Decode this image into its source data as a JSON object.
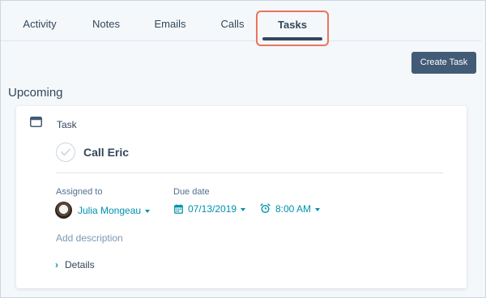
{
  "tabs": [
    {
      "label": "Activity"
    },
    {
      "label": "Notes"
    },
    {
      "label": "Emails"
    },
    {
      "label": "Calls"
    },
    {
      "label": "Tasks",
      "active": true
    }
  ],
  "toolbar": {
    "create_task_label": "Create Task"
  },
  "section": {
    "title": "Upcoming"
  },
  "task": {
    "type_label": "Task",
    "title": "Call Eric",
    "assigned_label": "Assigned to",
    "assignee": "Julia Mongeau",
    "due_label": "Due date",
    "due_date": "07/13/2019",
    "due_time": "8:00 AM",
    "description_placeholder": "Add description",
    "details_label": "Details"
  },
  "colors": {
    "accent": "#0091ae",
    "button": "#425b76",
    "highlight": "#e8755d",
    "text": "#33475b"
  },
  "icons": {
    "task_type": "task-icon",
    "check": "checkmark-icon",
    "calendar": "calendar-icon",
    "alarm": "alarm-clock-icon",
    "chevron": "chevron-right-icon"
  }
}
